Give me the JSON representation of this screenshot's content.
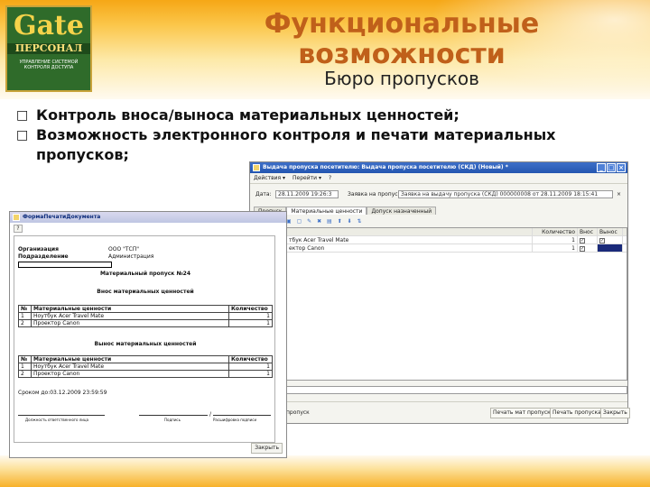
{
  "slide": {
    "title": "Функциональные возможности",
    "subtitle": "Бюро пропусков",
    "bullets": [
      "Контроль вноса/выноса материальных ценностей;",
      "Возможность электронного контроля и печати материальных пропусков;"
    ],
    "bullet_icon": "bullet-square-icon",
    "accent_color": "#c0601a"
  },
  "logo": {
    "word": "Gate",
    "subword": "ПЕРСОНАЛ",
    "caption": "УПРАВЛЕНИЕ СИСТЕМОЙ КОНТРОЛЯ ДОСТУПА"
  },
  "back_window": {
    "title": "Выдача пропуска посетителю: Выдача пропуска посетителю (СКД) (Новый) *",
    "toolbar": [
      "Действия ▾",
      "Перейти ▾",
      "?"
    ],
    "date_label": "Дата:",
    "date_value": "28.11.2009 19:26:3",
    "request_label": "Заявка на пропуск:",
    "request_value": "Заявка на выдачу пропуска (СКД) 000000008 от 28.11.2009 18:15:41",
    "pass_label": "Пропуск",
    "tabs": [
      "Материальные ценности",
      "Допуск назначенный"
    ],
    "grid_headers": [
      "Количество",
      "Внос",
      "Вынос"
    ],
    "rows": [
      {
        "name": "тбук Acer Travel Mate",
        "qty": "1"
      },
      {
        "name": "ектор Canon",
        "qty": "1"
      }
    ],
    "bottom_label": "пропуск",
    "buttons": [
      "Печать мат пропуска",
      "Печать пропуска",
      "Закрыть"
    ]
  },
  "front_window": {
    "title": "ФормаПечатиДокумента",
    "help": "?",
    "org_label": "Организация",
    "org_value": "ООО \"ТСП\"",
    "dept_label": "Подразделение",
    "dept_value": "Администрация",
    "doc_title": "Материальный пропуск №24",
    "in_title": "Внос материальных ценностей",
    "out_title": "Вынос материальных ценностей",
    "headers": [
      "№",
      "Материальные ценности",
      "Количество"
    ],
    "items": [
      {
        "n": "1",
        "name": "Ноутбук Acer Travel Mate",
        "qty": "1"
      },
      {
        "n": "2",
        "name": "Проектор Canon",
        "qty": "1"
      }
    ],
    "term": "Сроком до:03.12.2009 23:59:59",
    "sign_captions": [
      "Должность ответственного лица",
      "Подпись",
      "Расшифровка подписи"
    ],
    "close": "Закрыть"
  }
}
